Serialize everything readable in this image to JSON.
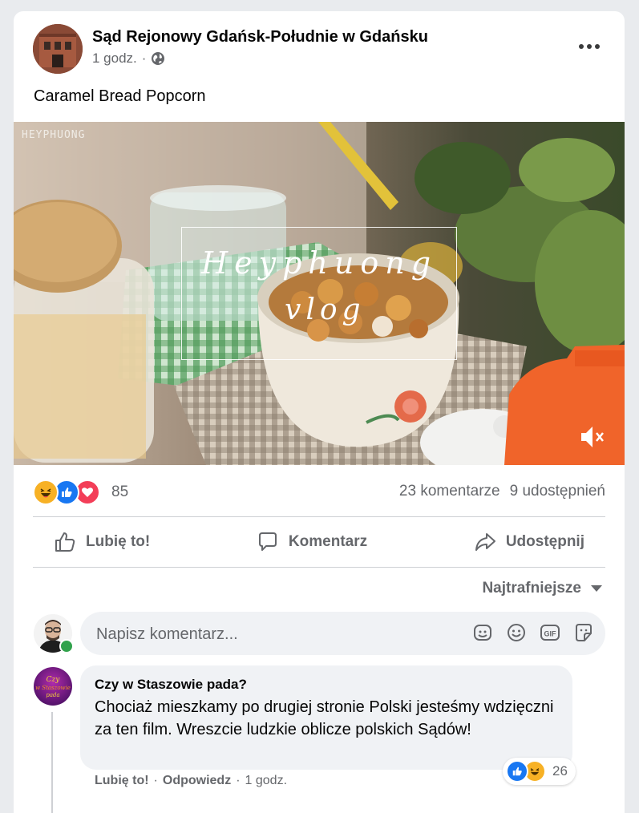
{
  "post": {
    "page_name": "Sąd Rejonowy Gdańsk-Południe w Gdańsku",
    "time": "1 godz.",
    "separator": "·",
    "privacy_icon": "globe-icon",
    "text": "Caramel Bread Popcorn"
  },
  "video": {
    "watermark": "HEYPHUONG",
    "title_line1": "Heyphuong",
    "title_line2": "vlog",
    "muted": true
  },
  "stats": {
    "reaction_count": "85",
    "reaction_types": [
      "haha",
      "like",
      "love"
    ],
    "comments": "23 komentarze",
    "shares": "9 udostępnień"
  },
  "actions": {
    "like": "Lubię to!",
    "comment": "Komentarz",
    "share": "Udostępnij"
  },
  "sort": {
    "label": "Najtrafniejsze"
  },
  "composer": {
    "placeholder": "Napisz komentarz..."
  },
  "comment": {
    "author": "Czy w Staszowie pada?",
    "avatar_text": "Czy w Staszowie pada",
    "text": "Chociaż mieszkamy po drugiej stronie Polski jesteśmy wdzięczni za ten film. Wreszcie ludzkie oblicze polskich Sądów!",
    "reaction_count": "26",
    "like": "Lubię to!",
    "reply": "Odpowiedz",
    "separator": "·",
    "time": "1 godz."
  },
  "colors": {
    "facebook_blue": "#1877f2",
    "secondary_text": "#65676b",
    "online_green": "#31a24c"
  }
}
